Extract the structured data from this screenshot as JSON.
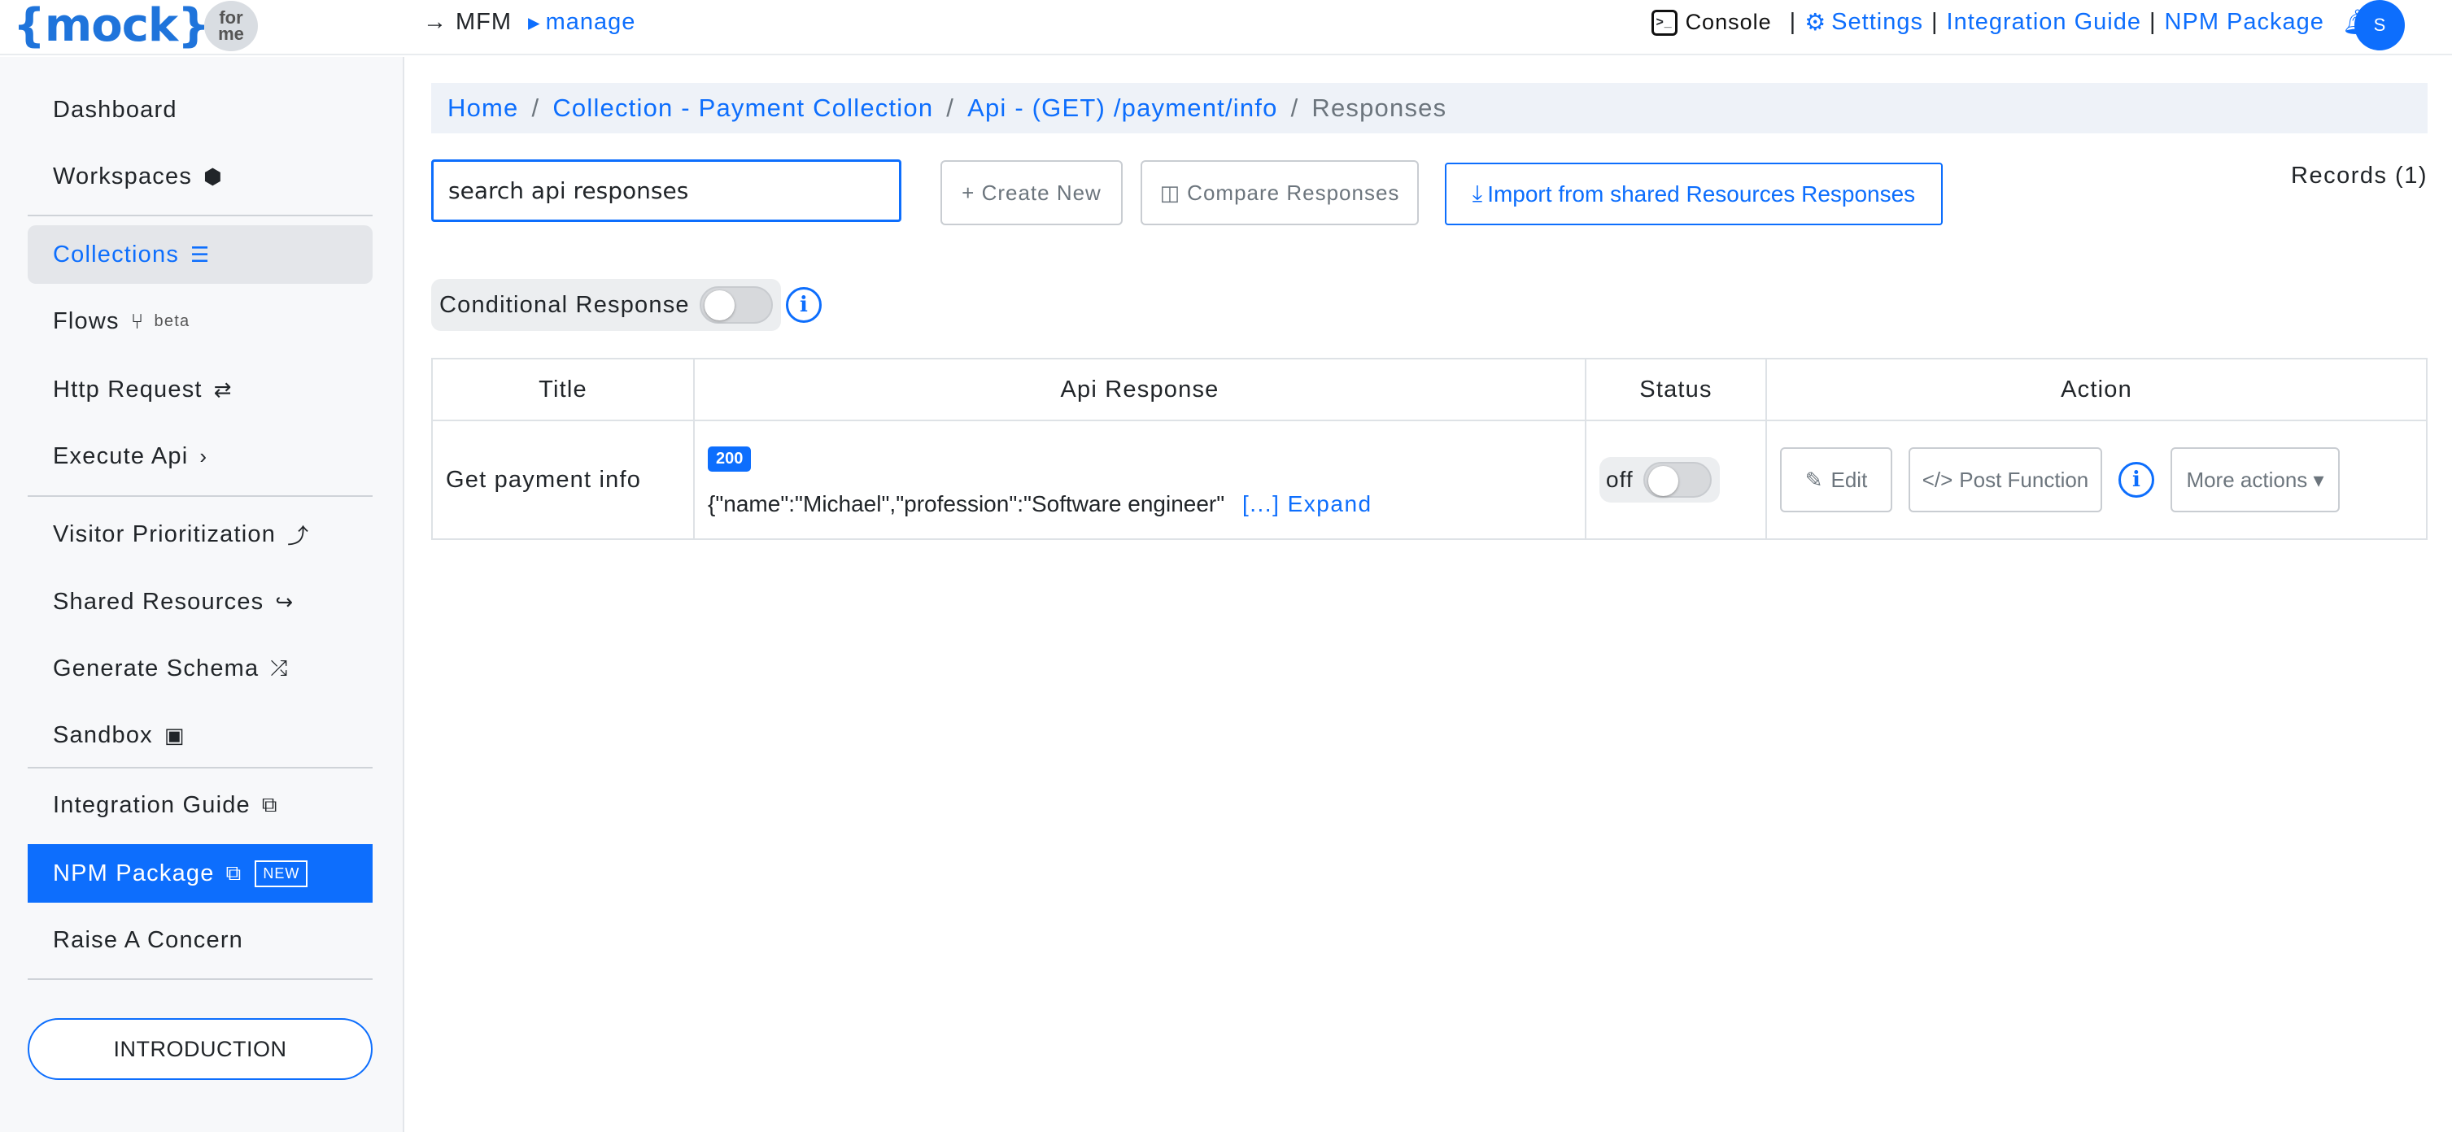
{
  "header": {
    "logo_text": "{mock}",
    "logo_bubble_top": "for",
    "logo_bubble_bottom": "me",
    "nav_arrow": "→",
    "mfm_label": "MFM",
    "manage_caret": "▸",
    "manage_label": "manage",
    "console_label": "Console",
    "settings_label": "Settings",
    "integration_label": "Integration Guide",
    "npm_label": "NPM Package",
    "separator": "|",
    "avatar_initial": "S"
  },
  "sidebar": {
    "items": [
      {
        "label": "Dashboard"
      },
      {
        "label": "Workspaces",
        "icon": "⬢"
      },
      {
        "label": "Collections",
        "icon": "☰"
      },
      {
        "label": "Flows",
        "icon": "⑂",
        "sup": "beta"
      },
      {
        "label": "Http Request",
        "icon": "⇄"
      },
      {
        "label": "Execute Api",
        "icon": "›"
      },
      {
        "label": "Visitor Prioritization",
        "icon": "⤴"
      },
      {
        "label": "Shared Resources",
        "icon": "↪"
      },
      {
        "label": "Generate Schema",
        "icon": "⤮"
      },
      {
        "label": "Sandbox",
        "icon": "▣"
      },
      {
        "label": "Integration Guide",
        "icon": "⧉"
      },
      {
        "label": "NPM Package",
        "icon": "⧉",
        "badge": "NEW"
      },
      {
        "label": "Raise A Concern"
      }
    ],
    "intro_button": "INTRODUCTION"
  },
  "breadcrumb": {
    "home": "Home",
    "collection": "Collection - Payment Collection",
    "api": "Api - (GET) /payment/info",
    "current": "Responses",
    "separator": "/"
  },
  "toolbar": {
    "search_value": "search api responses",
    "create_label": "+ Create New",
    "compare_icon": "◫",
    "compare_label": "Compare Responses",
    "import_icon": "⤓",
    "import_label": "Import from shared Resources Responses",
    "records_label": "Records (1)"
  },
  "conditional": {
    "label": "Conditional Response",
    "info_glyph": "i"
  },
  "table": {
    "headers": [
      "Title",
      "Api Response",
      "Status",
      "Action"
    ],
    "rows": [
      {
        "title": "Get payment info",
        "status_code": "200",
        "response_preview": "{\"name\":\"Michael\",\"profession\":\"Software engineer\"",
        "expand_label": "[...] Expand",
        "status_text": "off",
        "edit_icon": "✎",
        "edit_label": "Edit",
        "post_icon": "</>",
        "post_label": "Post Function",
        "info_glyph": "i",
        "more_label": "More actions ▾"
      }
    ]
  },
  "colors": {
    "accent": "#0d6efd",
    "sidebar_bg": "#f7f8fa",
    "breadcrumb_bg": "#eef2f8"
  }
}
